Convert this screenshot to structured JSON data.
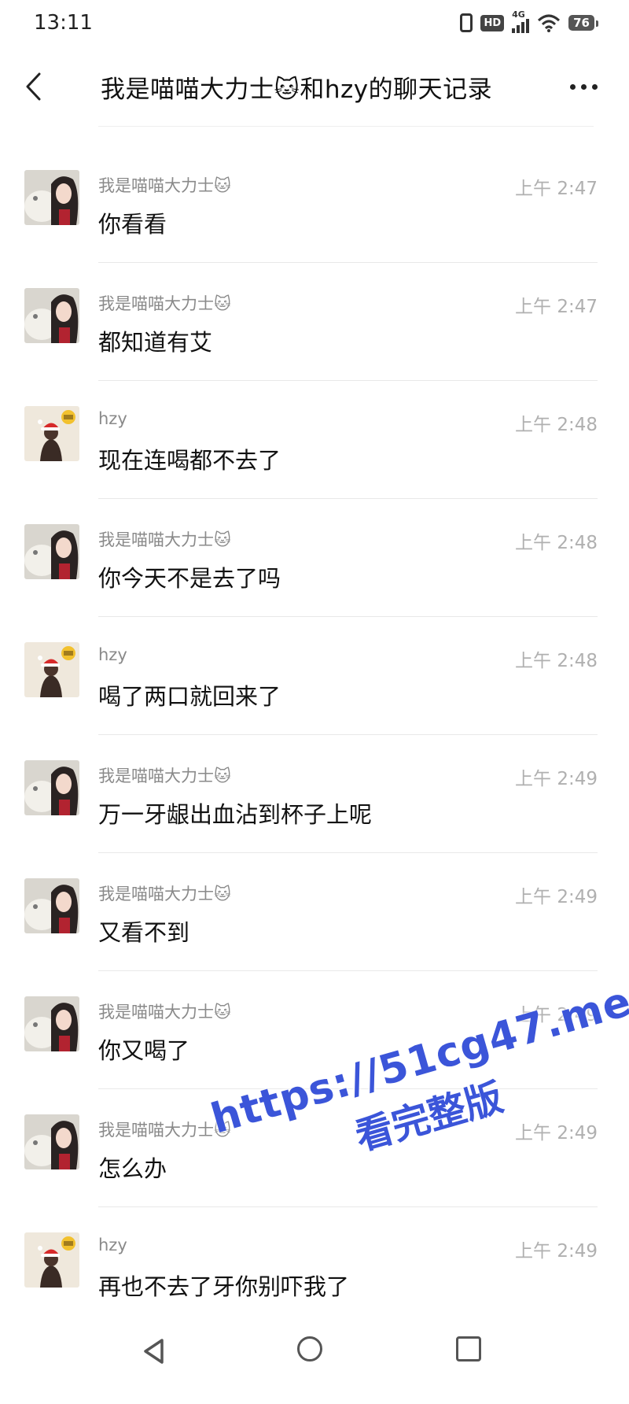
{
  "status_bar": {
    "time": "13:11",
    "network": "4G",
    "hd": "HD",
    "battery": "76"
  },
  "header": {
    "title": "我是喵喵大力士🐱和hzy的聊天记录",
    "back_icon": "chevron-left-icon",
    "more_icon": "more-horizontal-icon"
  },
  "messages": [
    {
      "sender": "我是喵喵大力士🐱",
      "time": "上午 2:47",
      "text": "你看看",
      "avatar": "girl-avatar"
    },
    {
      "sender": "我是喵喵大力士🐱",
      "time": "上午 2:47",
      "text": "都知道有艾",
      "avatar": "girl-avatar"
    },
    {
      "sender": "hzy",
      "time": "上午 2:48",
      "text": "现在连喝都不去了",
      "avatar": "santa-avatar"
    },
    {
      "sender": "我是喵喵大力士🐱",
      "time": "上午 2:48",
      "text": "你今天不是去了吗",
      "avatar": "girl-avatar"
    },
    {
      "sender": "hzy",
      "time": "上午 2:48",
      "text": "喝了两口就回来了",
      "avatar": "santa-avatar"
    },
    {
      "sender": "我是喵喵大力士🐱",
      "time": "上午 2:49",
      "text": "万一牙龈出血沾到杯子上呢",
      "avatar": "girl-avatar"
    },
    {
      "sender": "我是喵喵大力士🐱",
      "time": "上午 2:49",
      "text": "又看不到",
      "avatar": "girl-avatar"
    },
    {
      "sender": "我是喵喵大力士🐱",
      "time": "上午 2:49",
      "text": "你又喝了",
      "avatar": "girl-avatar"
    },
    {
      "sender": "我是喵喵大力士🐱",
      "time": "上午 2:49",
      "text": "怎么办",
      "avatar": "girl-avatar"
    },
    {
      "sender": "hzy",
      "time": "上午 2:49",
      "text": "再也不去了牙你别吓我了",
      "avatar": "santa-avatar"
    }
  ],
  "watermark": {
    "url": "https://51cg47.me",
    "subtitle": "看完整版"
  },
  "nav_bar": {
    "back_icon": "triangle-back-icon",
    "home_icon": "circle-home-icon",
    "recent_icon": "square-recents-icon"
  }
}
